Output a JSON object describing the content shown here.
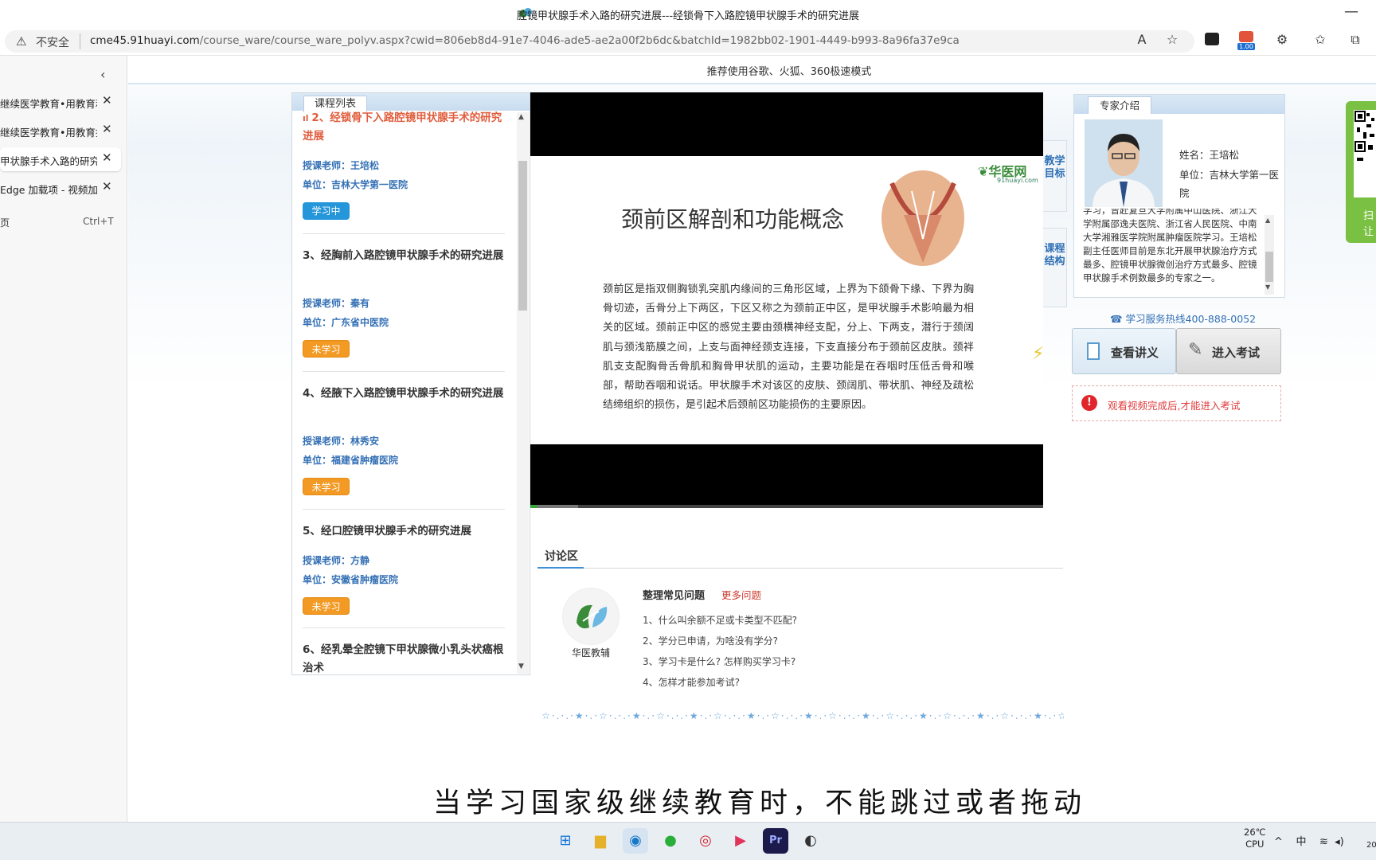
{
  "window": {
    "title": "腔镜甲状腺手术入路的研究进展---经锁骨下入路腔镜甲状腺手术的研究进展",
    "minimize_glyph": "—"
  },
  "addressbar": {
    "security_label": "不安全",
    "url_host": "cme45.91huayi.com",
    "url_path": "/course_ware/course_ware_polyv.aspx?cwid=806eb8d4-91e7-4046-ade5-ae2a00f2b6dc&batchId=1982bb02-1901-4449-b993-8a96fa37e9ca",
    "ext_badge": "1.00"
  },
  "sidebar": {
    "tabs": [
      {
        "label": "继续医学教育•用教育和",
        "active": false
      },
      {
        "label": "继续医学教育•用教育推",
        "active": false
      },
      {
        "label": "甲状腺手术入路的研究",
        "active": true
      },
      {
        "label": "Edge 加载项 - 视频加速",
        "active": false
      }
    ],
    "new_tab": {
      "label": "页",
      "shortcut": "Ctrl+T"
    }
  },
  "page": {
    "top_note": "推荐使用谷歌、火狐、360极速模式"
  },
  "course_list": {
    "tab_label": "课程列表",
    "items": [
      {
        "title": "2、经锁骨下入路腔镜甲状腺手术的研究进展",
        "teacher": "授课老师：王培松",
        "unit": "单位：吉林大学第一医院",
        "status": "学习中",
        "current": true
      },
      {
        "title": "3、经胸前入路腔镜甲状腺手术的研究进展",
        "teacher": "授课老师：秦有",
        "unit": "单位：广东省中医院",
        "status": "未学习",
        "current": false
      },
      {
        "title": "4、经腋下入路腔镜甲状腺手术的研究进展",
        "teacher": "授课老师：林秀安",
        "unit": "单位：福建省肿瘤医院",
        "status": "未学习",
        "current": false
      },
      {
        "title": "5、经口腔镜甲状腺手术的研究进展",
        "teacher": "授课老师：方静",
        "unit": "单位：安徽省肿瘤医院",
        "status": "未学习",
        "current": false
      },
      {
        "title": "6、经乳晕全腔镜下甲状腺微小乳头状癌根治术",
        "teacher": "",
        "unit": "",
        "status": "",
        "current": false
      }
    ]
  },
  "video": {
    "slide_title": "颈前区解剖和功能概念",
    "slide_logo": "华医网",
    "slide_logo_sub": "91huayi.com",
    "slide_body": "颈前区是指双侧胸锁乳突肌内缘间的三角形区域，上界为下颌骨下缘、下界为胸骨切迹，舌骨分上下两区，下区又称之为颈前正中区，是甲状腺手术影响最为相关的区域。颈前正中区的感觉主要由颈横神经支配，分上、下两支，潜行于颈阔肌与颈浅筋膜之间，上支与面神经颈支连接，下支直接分布于颈前区皮肤。颈袢肌支支配胸骨舌骨肌和胸骨甲状肌的运动，主要功能是在吞咽时压低舌骨和喉部，帮助吞咽和说话。甲状腺手术对该区的皮肤、颈阔肌、带状肌、神经及疏松结缔组织的损伤，是引起术后颈前区功能损伤的主要原因。"
  },
  "side_tabs": [
    "教学目标",
    "课程结构"
  ],
  "expert": {
    "tab_label": "专家介绍",
    "name": "姓名：王培松",
    "unit": "单位：吉林大学第一医院",
    "bio": "学习，曾赴复旦大学附属中山医院、浙江大学附属邵逸夫医院、浙江省人民医院、中南大学湘雅医学院附属肿瘤医院学习。王培松副主任医师目前是东北开展甲状腺治疗方式最多、腔镜甲状腺微创治疗方式最多、腔镜甲状腺手术例数最多的专家之一。",
    "hotline": "学习服务热线400-888-0052"
  },
  "actions": {
    "notes_label": "查看讲义",
    "exam_label": "进入考试",
    "notice": "观看视频完成后,才能进入考试"
  },
  "discussion": {
    "tab_label": "讨论区",
    "logo_label": "华医教辅",
    "faq_title": "整理常见问题",
    "faq_more": "更多问题",
    "faqs": [
      "1、什么叫余额不足或卡类型不匹配?",
      "2、学分已申请，为啥没有学分?",
      "3、学习卡是什么? 怎样购买学习卡?",
      "4、怎样才能参加考试?"
    ]
  },
  "caption": "当学习国家级继续教育时，不能跳过或者拖动",
  "qr": {
    "line1": "扫",
    "line2": "让"
  },
  "taskbar": {
    "weather_temp": "26℃",
    "weather_label": "CPU",
    "ime": "中",
    "clock": "20"
  }
}
